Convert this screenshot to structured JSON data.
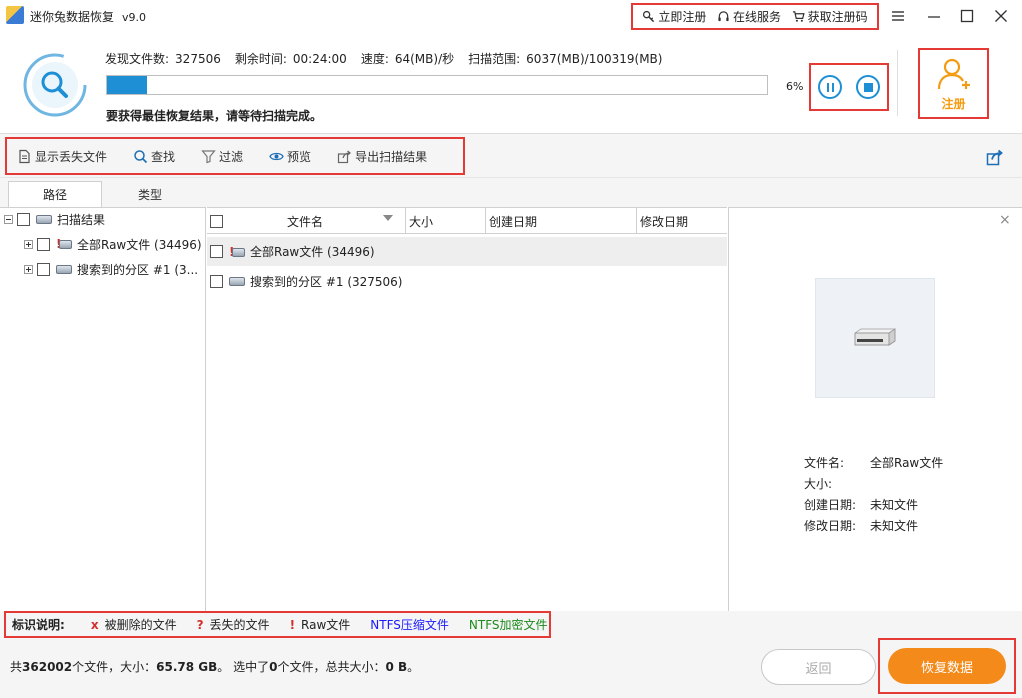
{
  "app": {
    "title": "迷你兔数据恢复",
    "version": "v9.0"
  },
  "top_links": [
    {
      "label": "立即注册",
      "icon": "key-icon"
    },
    {
      "label": "在线服务",
      "icon": "headset-icon"
    },
    {
      "label": "获取注册码",
      "icon": "cart-icon"
    }
  ],
  "scan": {
    "found_label": "发现文件数:",
    "found_value": "327506",
    "remaining_label": "剩余时间:",
    "remaining_value": "00:24:00",
    "speed_label": "速度:",
    "speed_value": "64(MB)/秒",
    "range_label": "扫描范围:",
    "range_value": "6037(MB)/100319(MB)",
    "progress_text": "6%",
    "progress_fraction": 0.06,
    "message": "要获得最佳恢复结果，请等待扫描完成。"
  },
  "register": {
    "label": "注册"
  },
  "toolbar": {
    "show_lost": "显示丢失文件",
    "find": "查找",
    "filter": "过滤",
    "preview": "预览",
    "export": "导出扫描结果"
  },
  "tabs": {
    "path": "路径",
    "type": "类型"
  },
  "tree": {
    "root": "扫描结果",
    "items": [
      "全部Raw文件 (34496)",
      "搜索到的分区 #1 (3..."
    ]
  },
  "list": {
    "headers": {
      "name": "文件名",
      "size": "大小",
      "created": "创建日期",
      "modified": "修改日期"
    },
    "rows": [
      "全部Raw文件 (34496)",
      "搜索到的分区 #1 (327506)"
    ]
  },
  "preview": {
    "close": "×",
    "name_label": "文件名:",
    "name_value": "全部Raw文件",
    "size_label": "大小:",
    "size_value": "",
    "created_label": "创建日期:",
    "created_value": "未知文件",
    "modified_label": "修改日期:",
    "modified_value": "未知文件"
  },
  "legend": {
    "title": "标识说明:",
    "deleted_mark": "x",
    "deleted": "被删除的文件",
    "lost_mark": "?",
    "lost": "丢失的文件",
    "raw_mark": "!",
    "raw": "Raw文件",
    "ntfs_compressed": "NTFS压缩文件",
    "ntfs_encrypted": "NTFS加密文件",
    "colors": {
      "mark": "#d32f2f",
      "compressed": "#1a1aff",
      "encrypted": "#1b8a1b"
    }
  },
  "status": {
    "p1": "共",
    "total_files": "362002",
    "p2": "个文件，大小：",
    "total_size": "65.78 GB",
    "p3": "。 选中了",
    "selected_count": "0",
    "p4": "个文件，总共大小：",
    "selected_size": "0 B",
    "p5": "。"
  },
  "buttons": {
    "back": "返回",
    "recover": "恢复数据"
  },
  "colors": {
    "accent": "#1e8fd5",
    "orange": "#f38a1a",
    "highlight": "#e53935"
  }
}
